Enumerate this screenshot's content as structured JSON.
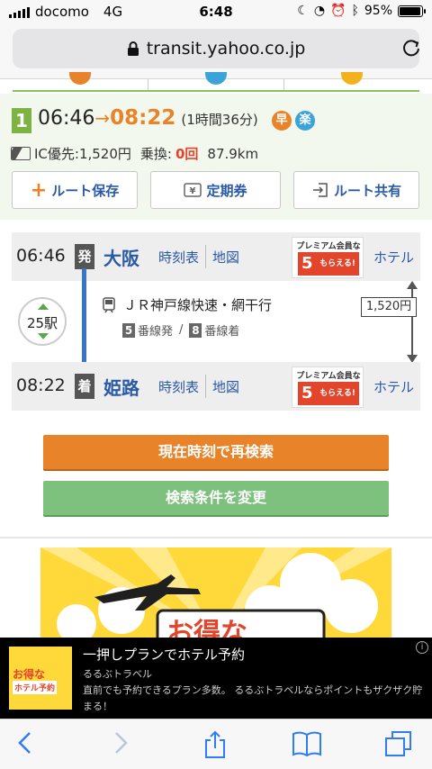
{
  "status": {
    "carrier": "docomo",
    "network": "4G",
    "time": "6:48",
    "battery": "95%"
  },
  "browser": {
    "url": "transit.yahoo.co.jp"
  },
  "route": {
    "number": "1",
    "depart": "06:46",
    "arrow": "→",
    "arrive": "08:22",
    "duration": "(1時間36分)",
    "badge_fast": "早",
    "badge_easy": "楽",
    "ic_label": "IC優先:1,520円",
    "transfers_label": "乗換:",
    "transfers_value": "0回",
    "distance": "87.9km",
    "buttons": {
      "save": "ルート保存",
      "pass": "定期券",
      "share": "ルート共有"
    }
  },
  "timetable": {
    "origin": {
      "time": "06:46",
      "mark": "発",
      "name": "大阪",
      "timetable": "時刻表",
      "map": "地図",
      "hotel": "ホテル"
    },
    "destination": {
      "time": "08:22",
      "mark": "着",
      "name": "姫路",
      "timetable": "時刻表",
      "map": "地図",
      "hotel": "ホテル"
    },
    "stops": "25駅",
    "train": "ＪＲ神戸線快速・網干行",
    "platform_dep_num": "5",
    "platform_dep_text": "番線発",
    "platform_sep": "/",
    "platform_arr_num": "8",
    "platform_arr_text": "番線着",
    "fare": "1,520円",
    "promo": {
      "title": "プレミアム会員なら",
      "pct": "5",
      "text": "もらえる!"
    }
  },
  "actions": {
    "research": "現在時刻で再検索",
    "change": "検索条件を変更"
  },
  "ad": {
    "banner_text": "お得な",
    "thumb_text1": "お得な",
    "thumb_text2": "ホテル予約",
    "title": "一押しプランでホテル予約",
    "advertiser": "るるぶトラベル",
    "body": "直前でも予約できるプラン多数。 るるぶトラベルならポイントもザクザク貯まる！"
  },
  "colors": {
    "green": "#7cb342",
    "orange": "#e8832a",
    "blue": "#2a5aa6",
    "red": "#e2452b",
    "line": "#3a74c8"
  }
}
